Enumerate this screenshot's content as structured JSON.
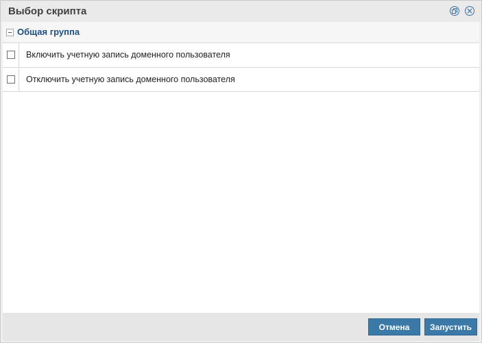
{
  "dialog": {
    "title": "Выбор скрипта"
  },
  "group": {
    "label": "Общая группа",
    "expanded": true,
    "items": [
      {
        "label": "Включить учетную запись доменного пользователя",
        "checked": false
      },
      {
        "label": "Отключить учетную запись доменного пользователя",
        "checked": false
      }
    ]
  },
  "footer": {
    "cancel_label": "Отмена",
    "run_label": "Запустить"
  },
  "colors": {
    "primary_button": "#3b79a8",
    "group_label": "#1d4e80"
  }
}
